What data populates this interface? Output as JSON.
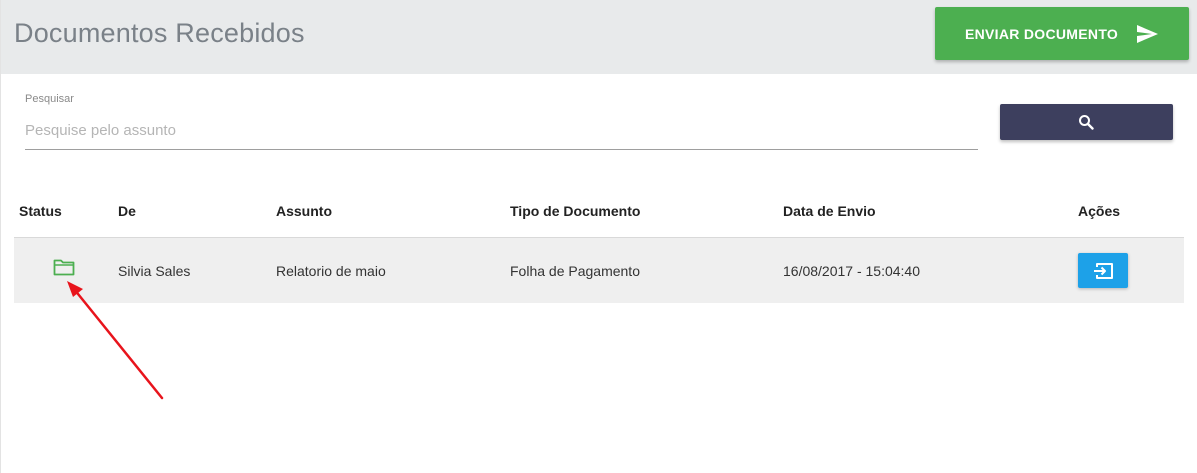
{
  "header": {
    "title": "Documentos Recebidos",
    "send_button_label": "ENVIAR DOCUMENTO",
    "send_icon": "send-icon"
  },
  "search": {
    "label": "Pesquisar",
    "placeholder": "Pesquise pelo assunto",
    "value": "",
    "button_icon": "search-icon"
  },
  "table": {
    "columns": [
      "Status",
      "De",
      "Assunto",
      "Tipo de Documento",
      "Data de Envio",
      "Ações"
    ],
    "rows": [
      {
        "status_icon": "folder-icon",
        "de": "Silvia Sales",
        "assunto": "Relatorio de maio",
        "tipo": "Folha de Pagamento",
        "data_envio": "16/08/2017 - 15:04:40",
        "action_icon": "open-icon"
      }
    ]
  },
  "colors": {
    "header_bg": "#e8eaeb",
    "send_button": "#4caf50",
    "search_button": "#3d3f5e",
    "action_button": "#1da1e8",
    "folder_icon": "#4caf50",
    "annotation_arrow": "#e8141c"
  }
}
